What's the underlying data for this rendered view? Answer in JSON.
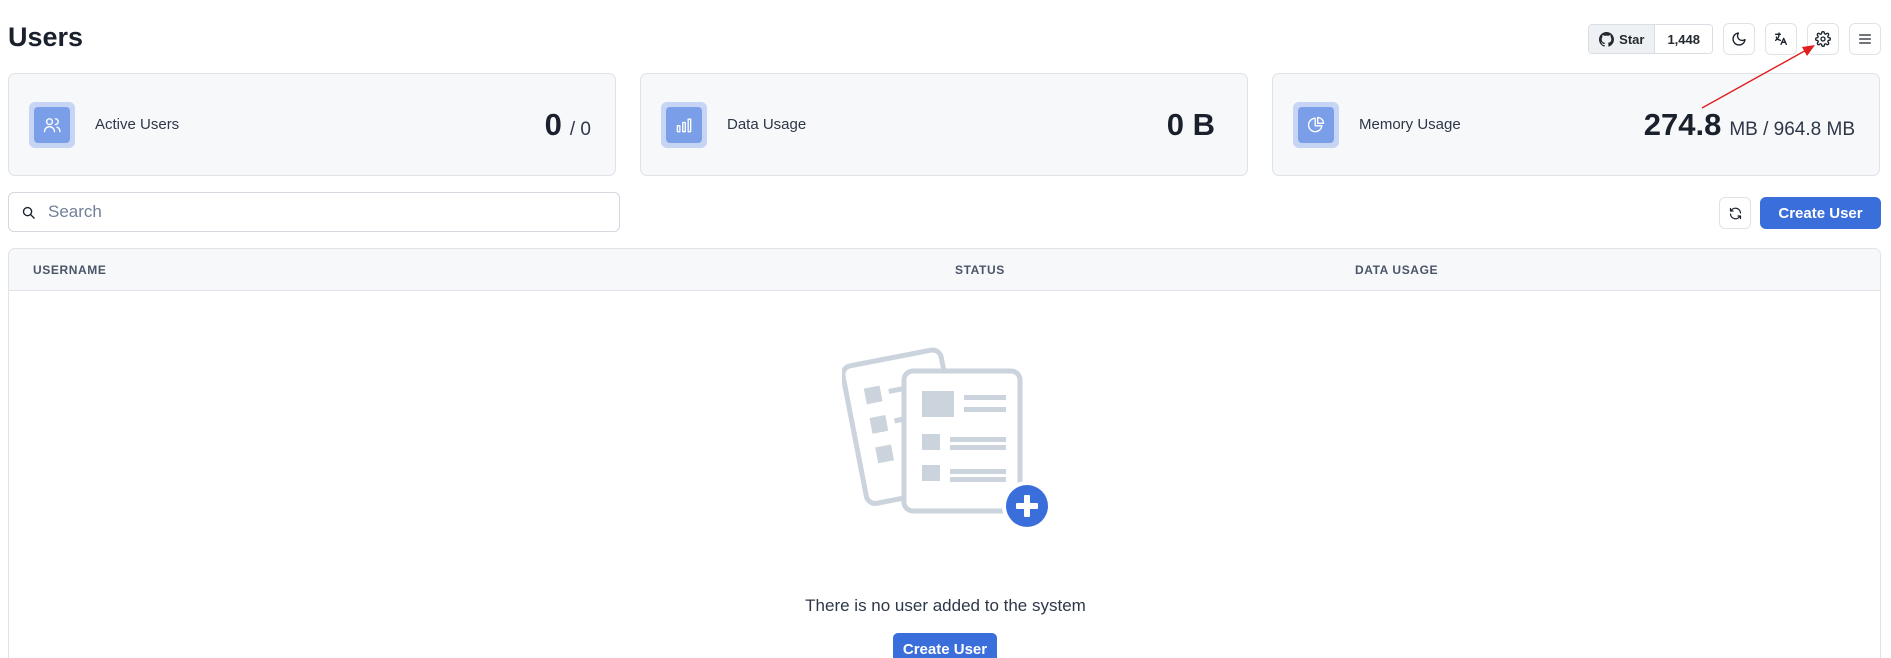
{
  "header": {
    "title": "Users",
    "github": {
      "star_label": "Star",
      "star_count": "1,448"
    },
    "icons": [
      "github-icon",
      "moon-icon",
      "translate-icon",
      "gear-icon",
      "menu-icon"
    ]
  },
  "stats": [
    {
      "label": "Active Users",
      "value": "0",
      "sub": "/ 0",
      "icon": "users-icon"
    },
    {
      "label": "Data Usage",
      "value": "0 B",
      "sub": "",
      "icon": "bar-chart-icon"
    },
    {
      "label": "Memory Usage",
      "value": "274.8",
      "sub": "MB / 964.8 MB",
      "icon": "pie-chart-icon"
    }
  ],
  "toolbar": {
    "search_placeholder": "Search",
    "search_value": "",
    "create_label": "Create User"
  },
  "table": {
    "columns": [
      "USERNAME",
      "STATUS",
      "DATA USAGE"
    ],
    "rows": []
  },
  "empty_state": {
    "message": "There is no user added to the system",
    "create_label": "Create User"
  },
  "colors": {
    "accent": "#3a6fdb",
    "card_bg": "#f7f8fa",
    "stat_icon": "#7b9ee9",
    "annotation_arrow": "#e02020"
  }
}
